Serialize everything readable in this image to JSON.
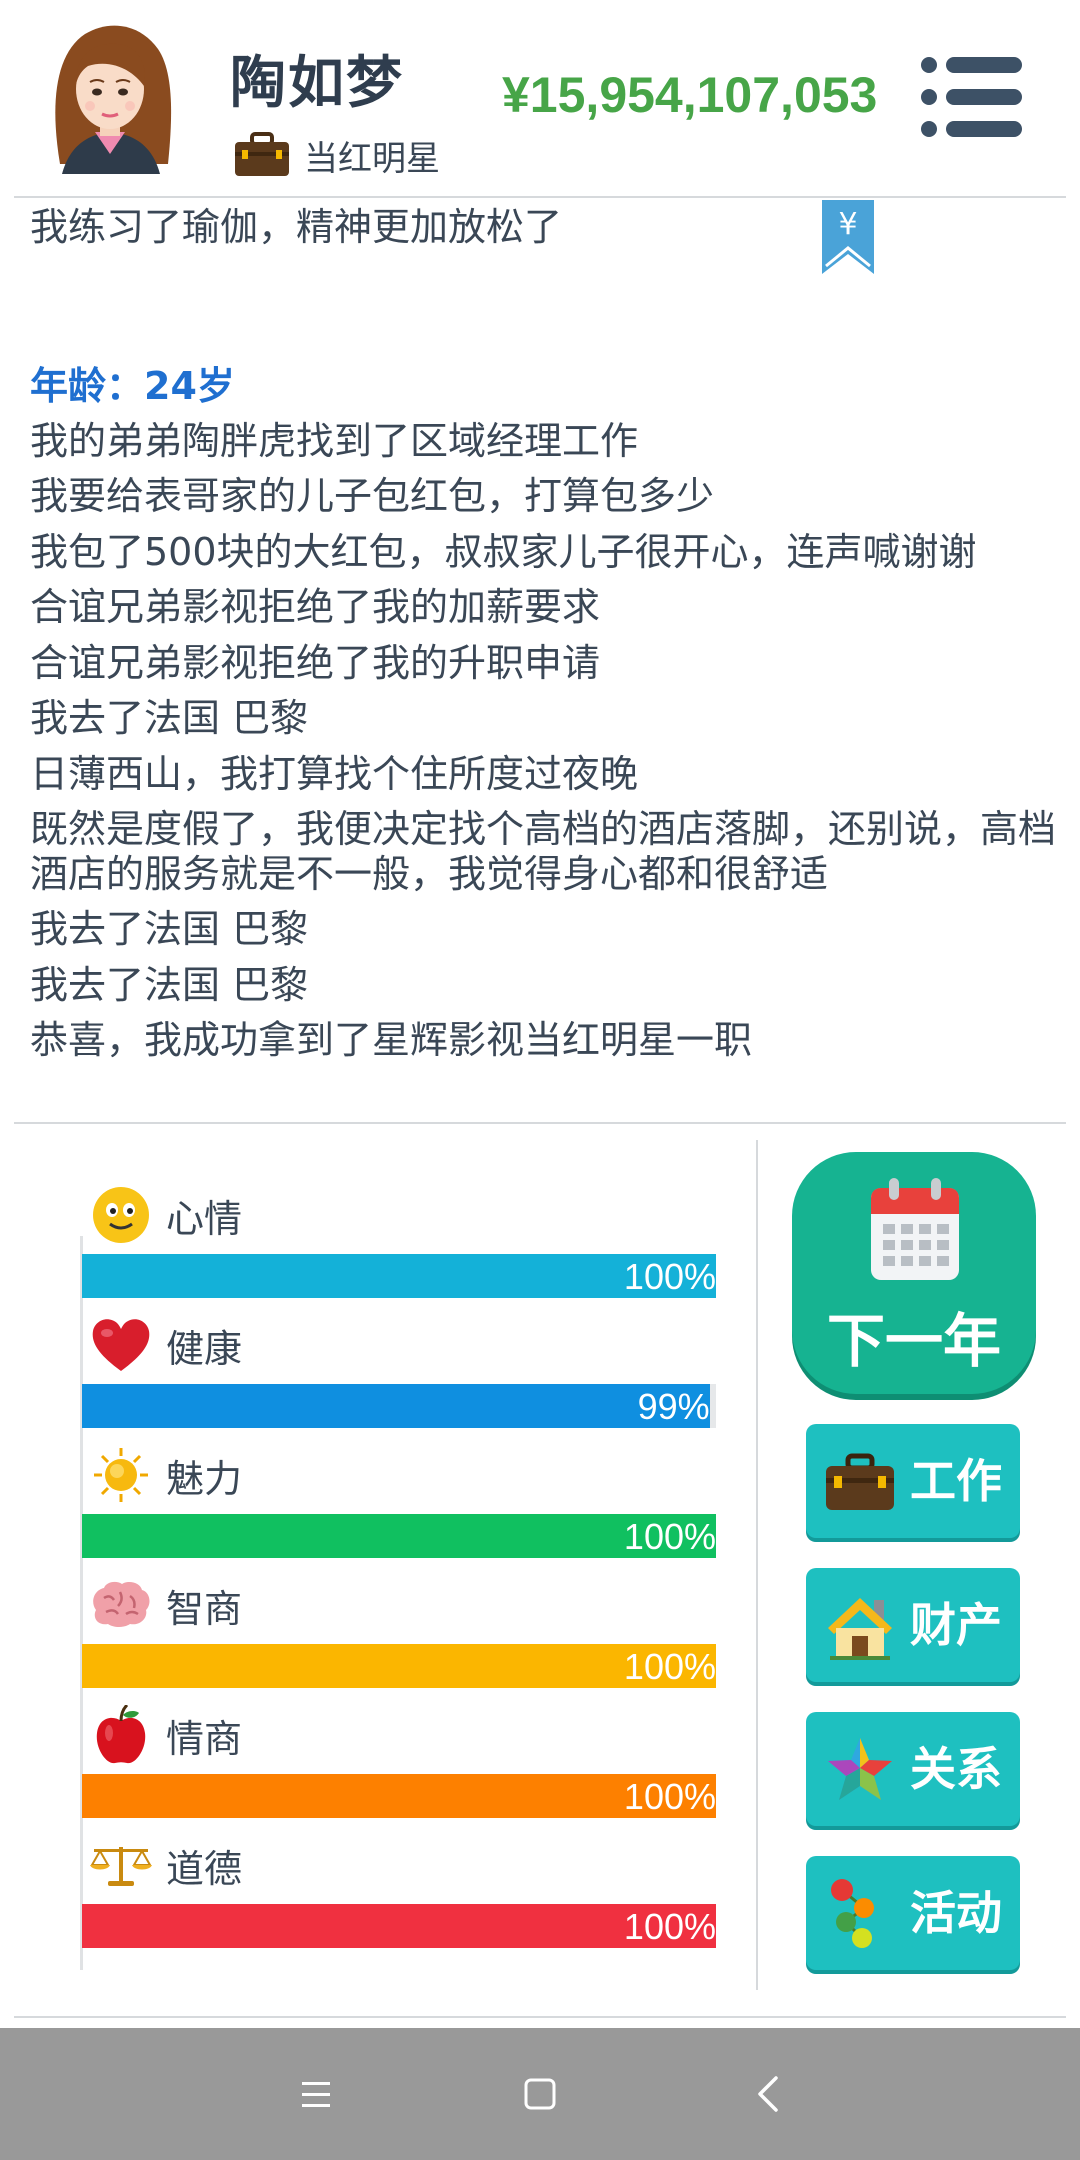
{
  "header": {
    "name": "陶如梦",
    "job": "当红明星",
    "money": "¥15,954,107,053"
  },
  "log": {
    "lines_before_age": [
      "我练习了瑜伽，精神更加放松了"
    ],
    "age": "年龄：24岁",
    "lines": [
      "我的弟弟陶胖虎找到了区域经理工作",
      "我要给表哥家的儿子包红包，打算包多少",
      "我包了500块的大红包，叔叔家儿子很开心，连声喊谢谢",
      "合谊兄弟影视拒绝了我的加薪要求",
      "合谊兄弟影视拒绝了我的升职申请",
      "我去了法国 巴黎",
      "日薄西山，我打算找个住所度过夜晚",
      "既然是度假了，我便决定找个高档的酒店落脚，还别说，高档酒店的服务就是不一般，我觉得身心都和很舒适",
      "我去了法国 巴黎",
      "我去了法国 巴黎",
      "恭喜，我成功拿到了星辉影视当红明星一职"
    ],
    "bookmark_symbol": "¥"
  },
  "stats": [
    {
      "label": "心情",
      "value": 100,
      "pct_text": "100%",
      "color": "#14b1d8",
      "icon": "smiley-icon"
    },
    {
      "label": "健康",
      "value": 99,
      "pct_text": "99%",
      "color": "#0f8fe0",
      "icon": "heart-icon"
    },
    {
      "label": "魅力",
      "value": 100,
      "pct_text": "100%",
      "color": "#10c060",
      "icon": "sun-icon"
    },
    {
      "label": "智商",
      "value": 100,
      "pct_text": "100%",
      "color": "#fbb600",
      "icon": "brain-icon"
    },
    {
      "label": "情商",
      "value": 100,
      "pct_text": "100%",
      "color": "#fd8000",
      "icon": "apple-icon"
    },
    {
      "label": "道德",
      "value": 100,
      "pct_text": "100%",
      "color": "#f03040",
      "icon": "scales-icon"
    }
  ],
  "actions": {
    "next_year": "下一年",
    "work": "工作",
    "property": "财产",
    "relations": "关系",
    "activities": "活动"
  },
  "colors": {
    "money": "#47a548",
    "age": "#1f6fd0",
    "next_year_bg": "#16b391",
    "side_btn_bg": "#1ec0c0"
  }
}
